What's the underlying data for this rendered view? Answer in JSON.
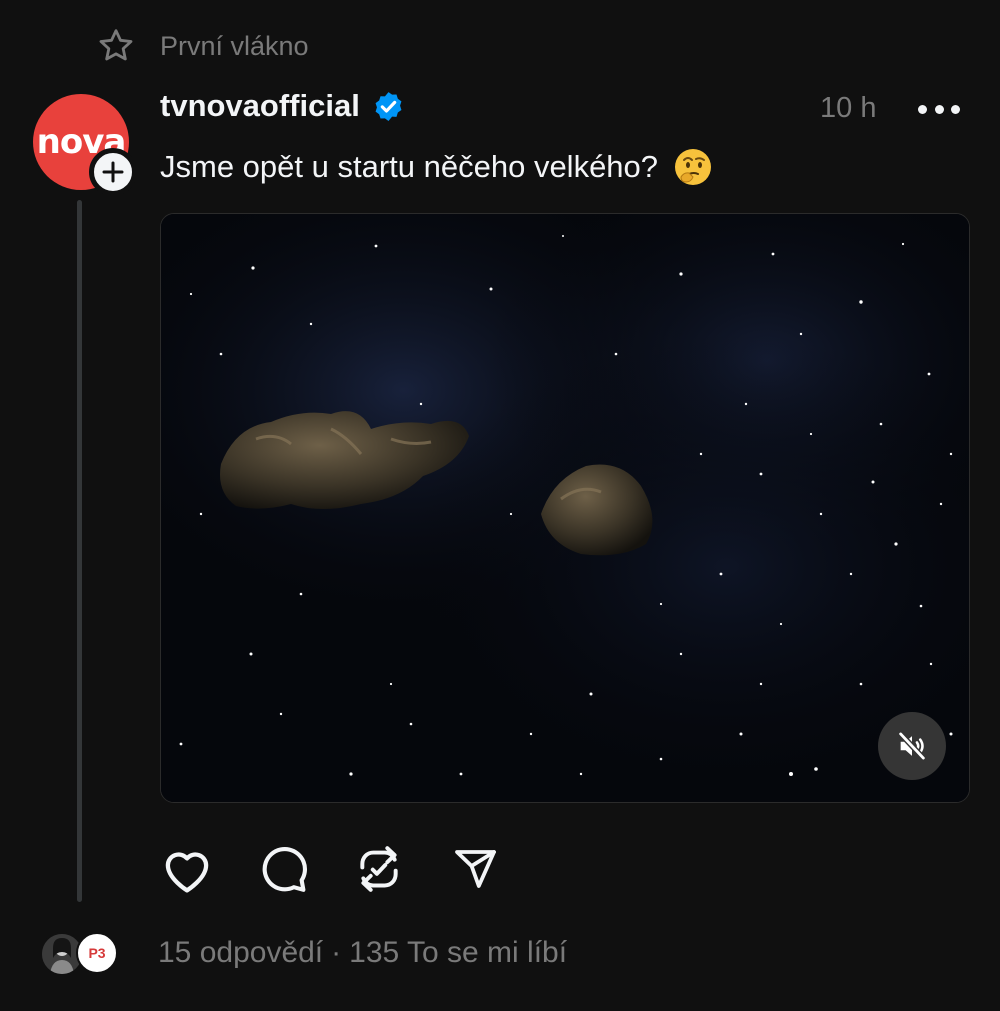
{
  "thread": {
    "header_label": "První vlákno"
  },
  "post": {
    "author": "tvnovaofficial",
    "avatar_text": "nova",
    "time": "10 h",
    "text": "Jsme opět u startu něčeho velkého?",
    "emoji": "thinking-face",
    "media": {
      "type": "video",
      "muted": true
    }
  },
  "actions": [
    "like",
    "reply",
    "repost",
    "share"
  ],
  "stats": {
    "replies": "15 odpovědí",
    "separator": "·",
    "likes": "135 To se mi líbí"
  },
  "repliers": {
    "second_avatar_text": "P3"
  },
  "colors": {
    "background": "#101010",
    "text": "#f3f5f7",
    "muted": "#7a7a7a",
    "verified": "#0095f6",
    "brand": "#e8413c"
  }
}
